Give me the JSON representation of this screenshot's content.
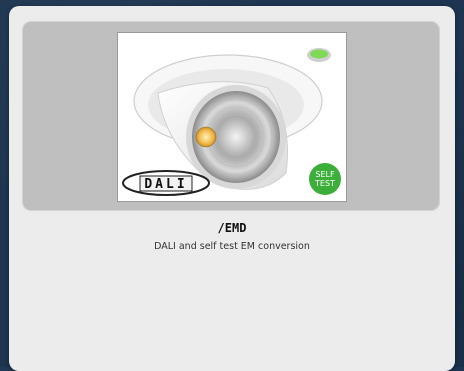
{
  "card": {
    "title": "/EMD",
    "subtitle": "DALI and self test EM conversion"
  },
  "image": {
    "dali_logo_text": "DALI",
    "self_test_badge": [
      "SELF",
      "TEST"
    ],
    "badge_color": "#3cae3a",
    "indicator_color": "#7ed957"
  }
}
